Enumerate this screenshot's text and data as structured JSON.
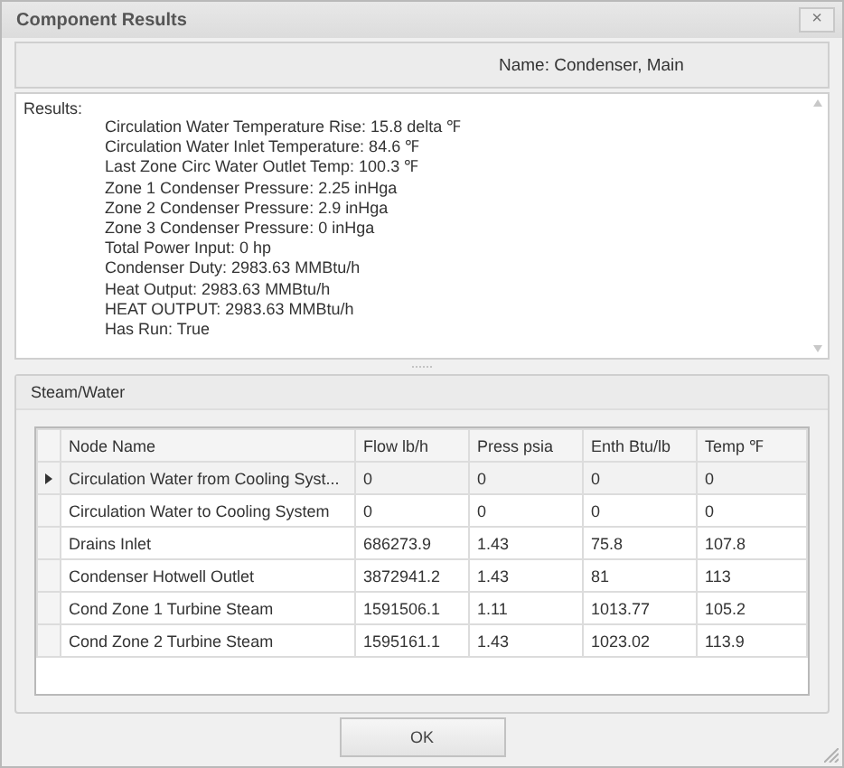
{
  "window": {
    "title": "Component Results",
    "close": "×"
  },
  "name_label": "Name: Condenser, Main",
  "results": {
    "heading": "Results:",
    "lines": [
      "Circulation Water Temperature Rise: 15.8 delta ℉",
      "Circulation Water Inlet Temperature: 84.6 ℉",
      "Last Zone Circ Water Outlet Temp: 100.3 ℉",
      "Zone 1 Condenser Pressure: 2.25 inHga",
      "Zone 2 Condenser Pressure: 2.9 inHga",
      "Zone 3 Condenser Pressure: 0 inHga",
      "Total Power Input: 0 hp",
      "Condenser Duty: 2983.63 MMBtu/h",
      "Heat Output: 2983.63 MMBtu/h",
      "HEAT OUTPUT: 2983.63 MMBtu/h",
      "Has Run: True"
    ]
  },
  "group": {
    "title": "Steam/Water"
  },
  "table": {
    "columns": [
      "Node Name",
      "Flow lb/h",
      "Press psia",
      "Enth Btu/lb",
      "Temp ℉"
    ],
    "rows": [
      {
        "selected": true,
        "cells": [
          "Circulation Water from Cooling Syst...",
          "0",
          "0",
          "0",
          "0"
        ]
      },
      {
        "selected": false,
        "cells": [
          "Circulation Water to Cooling System",
          "0",
          "0",
          "0",
          "0"
        ]
      },
      {
        "selected": false,
        "cells": [
          "Drains Inlet",
          "686273.9",
          "1.43",
          "75.8",
          "107.8"
        ]
      },
      {
        "selected": false,
        "cells": [
          "Condenser Hotwell Outlet",
          "3872941.2",
          "1.43",
          "81",
          "113"
        ]
      },
      {
        "selected": false,
        "cells": [
          "Cond Zone 1 Turbine Steam",
          "1591506.1",
          "1.11",
          "1013.77",
          "105.2"
        ]
      },
      {
        "selected": false,
        "cells": [
          "Cond Zone 2 Turbine Steam",
          "1595161.1",
          "1.43",
          "1023.02",
          "113.9"
        ]
      }
    ]
  },
  "buttons": [
    "OK"
  ]
}
